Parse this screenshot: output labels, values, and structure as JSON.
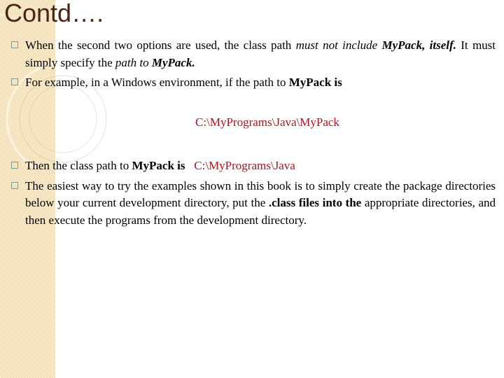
{
  "slide": {
    "title": "Contd….",
    "bullets": [
      {
        "text_1": "When the second two options are used, the class path ",
        "italic_1": "must not include ",
        "bolditalic_1": "MyPack, itself.",
        "text_2": " It must simply specify the ",
        "italic_2": "path to ",
        "bolditalic_2": "MyPack."
      },
      {
        "text_1": "For example, in a Windows environment, if the path to ",
        "bold_1": "MyPack is"
      },
      {
        "text_1": "Then the class path to ",
        "bold_1": "MyPack is",
        "code": "C:\\MyPrograms\\Java"
      },
      {
        "text_1": "The easiest way to try the examples shown in this book is to simply create the package directories below your current development directory, put the ",
        "bold_1": ".class files into the",
        "text_2": " appropriate directories, and then execute the programs from the development directory."
      }
    ],
    "example_path": "C:\\MyPrograms\\Java\\MyPack"
  },
  "colors": {
    "title": "#4a2416",
    "code": "#b0121b",
    "band": "#f3dfb3",
    "bullet": "#7a9a90"
  }
}
